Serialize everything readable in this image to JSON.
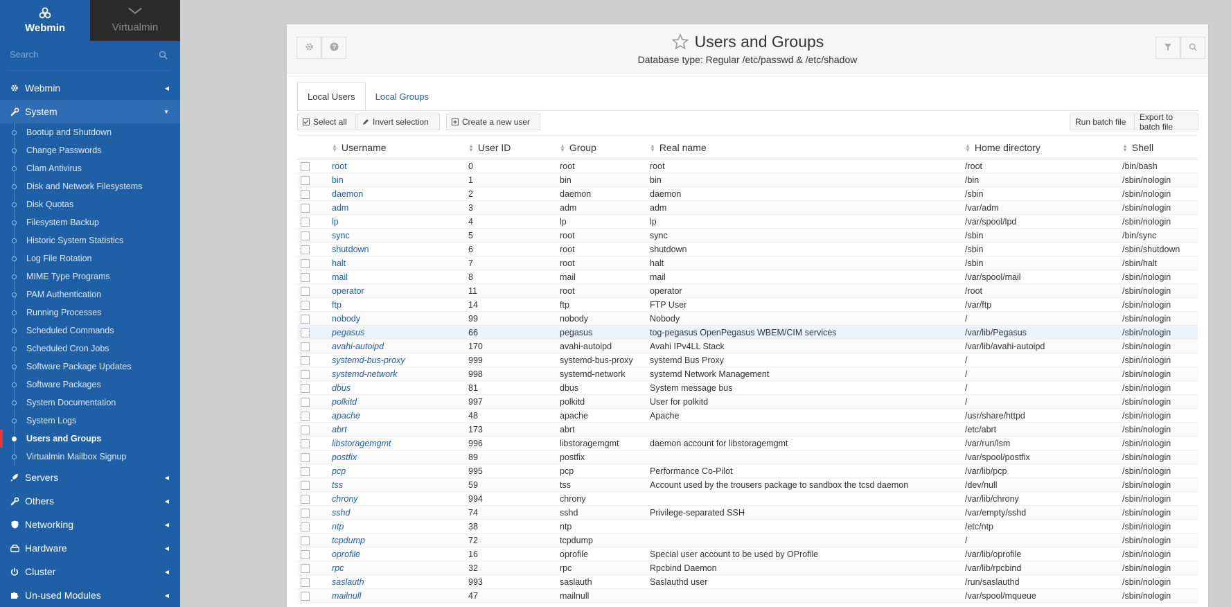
{
  "sidebar": {
    "switch": {
      "webmin": "Webmin",
      "virtualmin": "Virtualmin"
    },
    "search_placeholder": "Search",
    "categories_top": [
      {
        "label": "Webmin",
        "icon": "gear-icon"
      },
      {
        "label": "System",
        "icon": "wrench-icon"
      }
    ],
    "system_items": [
      "Bootup and Shutdown",
      "Change Passwords",
      "Clam Antivirus",
      "Disk and Network Filesystems",
      "Disk Quotas",
      "Filesystem Backup",
      "Historic System Statistics",
      "Log File Rotation",
      "MIME Type Programs",
      "PAM Authentication",
      "Running Processes",
      "Scheduled Commands",
      "Scheduled Cron Jobs",
      "Software Package Updates",
      "Software Packages",
      "System Documentation",
      "System Logs",
      "Users and Groups",
      "Virtualmin Mailbox Signup"
    ],
    "active_item": "Users and Groups",
    "categories_bottom": [
      {
        "label": "Servers",
        "icon": "rocket-icon"
      },
      {
        "label": "Others",
        "icon": "wrench-icon"
      },
      {
        "label": "Networking",
        "icon": "shield-icon"
      },
      {
        "label": "Hardware",
        "icon": "hdd-icon"
      },
      {
        "label": "Cluster",
        "icon": "power-icon"
      },
      {
        "label": "Un-used Modules",
        "icon": "puzzle-icon"
      }
    ]
  },
  "header": {
    "title": "Users and Groups",
    "subtitle": "Database type: Regular /etc/passwd & /etc/shadow"
  },
  "tabs": [
    "Local Users",
    "Local Groups"
  ],
  "toolbar": {
    "select_all": "Select all",
    "invert_selection": "Invert selection",
    "create_user": "Create a new user",
    "run_batch": "Run batch file",
    "export_batch": "Export to batch file"
  },
  "table": {
    "columns": [
      "Username",
      "User ID",
      "Group",
      "Real name",
      "Home directory",
      "Shell"
    ],
    "rows": [
      [
        "root",
        "0",
        "root",
        "root",
        "/root",
        "/bin/bash",
        false
      ],
      [
        "bin",
        "1",
        "bin",
        "bin",
        "/bin",
        "/sbin/nologin",
        false
      ],
      [
        "daemon",
        "2",
        "daemon",
        "daemon",
        "/sbin",
        "/sbin/nologin",
        false
      ],
      [
        "adm",
        "3",
        "adm",
        "adm",
        "/var/adm",
        "/sbin/nologin",
        false
      ],
      [
        "lp",
        "4",
        "lp",
        "lp",
        "/var/spool/lpd",
        "/sbin/nologin",
        false
      ],
      [
        "sync",
        "5",
        "root",
        "sync",
        "/sbin",
        "/bin/sync",
        false
      ],
      [
        "shutdown",
        "6",
        "root",
        "shutdown",
        "/sbin",
        "/sbin/shutdown",
        false
      ],
      [
        "halt",
        "7",
        "root",
        "halt",
        "/sbin",
        "/sbin/halt",
        false
      ],
      [
        "mail",
        "8",
        "mail",
        "mail",
        "/var/spool/mail",
        "/sbin/nologin",
        false
      ],
      [
        "operator",
        "11",
        "root",
        "operator",
        "/root",
        "/sbin/nologin",
        false
      ],
      [
        "ftp",
        "14",
        "ftp",
        "FTP User",
        "/var/ftp",
        "/sbin/nologin",
        false
      ],
      [
        "nobody",
        "99",
        "nobody",
        "Nobody",
        "/",
        "/sbin/nologin",
        false
      ],
      [
        "pegasus",
        "66",
        "pegasus",
        "tog-pegasus OpenPegasus WBEM/CIM services",
        "/var/lib/Pegasus",
        "/sbin/nologin",
        true
      ],
      [
        "avahi-autoipd",
        "170",
        "avahi-autoipd",
        "Avahi IPv4LL Stack",
        "/var/lib/avahi-autoipd",
        "/sbin/nologin",
        true
      ],
      [
        "systemd-bus-proxy",
        "999",
        "systemd-bus-proxy",
        "systemd Bus Proxy",
        "/",
        "/sbin/nologin",
        true
      ],
      [
        "systemd-network",
        "998",
        "systemd-network",
        "systemd Network Management",
        "/",
        "/sbin/nologin",
        true
      ],
      [
        "dbus",
        "81",
        "dbus",
        "System message bus",
        "/",
        "/sbin/nologin",
        true
      ],
      [
        "polkitd",
        "997",
        "polkitd",
        "User for polkitd",
        "/",
        "/sbin/nologin",
        true
      ],
      [
        "apache",
        "48",
        "apache",
        "Apache",
        "/usr/share/httpd",
        "/sbin/nologin",
        true
      ],
      [
        "abrt",
        "173",
        "abrt",
        "",
        "/etc/abrt",
        "/sbin/nologin",
        true
      ],
      [
        "libstoragemgmt",
        "996",
        "libstoragemgmt",
        "daemon account for libstoragemgmt",
        "/var/run/lsm",
        "/sbin/nologin",
        true
      ],
      [
        "postfix",
        "89",
        "postfix",
        "",
        "/var/spool/postfix",
        "/sbin/nologin",
        true
      ],
      [
        "pcp",
        "995",
        "pcp",
        "Performance Co-Pilot",
        "/var/lib/pcp",
        "/sbin/nologin",
        true
      ],
      [
        "tss",
        "59",
        "tss",
        "Account used by the trousers package to sandbox the tcsd daemon",
        "/dev/null",
        "/sbin/nologin",
        true
      ],
      [
        "chrony",
        "994",
        "chrony",
        "",
        "/var/lib/chrony",
        "/sbin/nologin",
        true
      ],
      [
        "sshd",
        "74",
        "sshd",
        "Privilege-separated SSH",
        "/var/empty/sshd",
        "/sbin/nologin",
        true
      ],
      [
        "ntp",
        "38",
        "ntp",
        "",
        "/etc/ntp",
        "/sbin/nologin",
        true
      ],
      [
        "tcpdump",
        "72",
        "tcpdump",
        "",
        "/",
        "/sbin/nologin",
        true
      ],
      [
        "oprofile",
        "16",
        "oprofile",
        "Special user account to be used by OProfile",
        "/var/lib/oprofile",
        "/sbin/nologin",
        true
      ],
      [
        "rpc",
        "32",
        "rpc",
        "Rpcbind Daemon",
        "/var/lib/rpcbind",
        "/sbin/nologin",
        true
      ],
      [
        "saslauth",
        "993",
        "saslauth",
        "Saslauthd user",
        "/run/saslauthd",
        "/sbin/nologin",
        true
      ],
      [
        "mailnull",
        "47",
        "mailnull",
        "",
        "/var/spool/mqueue",
        "/sbin/nologin",
        true
      ]
    ]
  },
  "colors": {
    "sidebar": "#1f5fa6",
    "active_marker": "#e53935",
    "link": "#1f5fa6"
  }
}
